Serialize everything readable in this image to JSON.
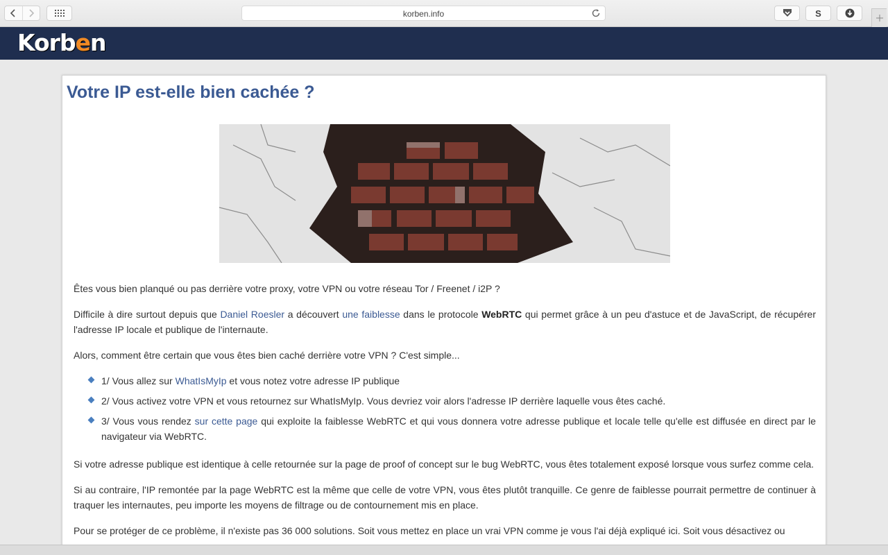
{
  "browser": {
    "url": "korben.info",
    "back_icon": "chevron-left-icon",
    "forward_icon": "chevron-right-icon",
    "grid_icon": "grid-icon",
    "reload_icon": "reload-icon",
    "ext_pocket_icon": "pocket-icon",
    "ext_s_label": "S",
    "ext_download_icon": "download-icon",
    "new_tab_icon": "plus-icon"
  },
  "site": {
    "logo_prefix": "Korb",
    "logo_accent": "e",
    "logo_suffix": "n",
    "header_color": "#1f2e4f",
    "accent_color": "#f08a24"
  },
  "article": {
    "title": "Votre IP est-elle bien cachée ?",
    "image_alt": "brick-wall-image",
    "p1": "Êtes vous bien planqué ou pas derrière votre proxy, votre VPN ou votre réseau Tor / Freenet / i2P ?",
    "p2": {
      "t1": "Difficile à dire surtout depuis que ",
      "link1": "Daniel Roesler",
      "t2": " a découvert ",
      "link2": "une faiblesse",
      "t3": " dans le protocole ",
      "bold": "WebRTC",
      "t4": " qui permet grâce à un peu d'astuce et de JavaScript, de récupérer l'adresse IP locale et publique de l'internaute."
    },
    "p3": "Alors, comment être certain que vous êtes bien caché derrière votre VPN ? C'est simple...",
    "list": {
      "i1_t1": "1/ Vous allez sur ",
      "i1_link": "WhatIsMyIp",
      "i1_t2": " et vous notez votre adresse IP publique",
      "i2": "2/ Vous activez votre VPN et vous retournez sur WhatIsMyIp. Vous devriez voir alors l'adresse IP derrière laquelle vous êtes caché.",
      "i3_t1": "3/ Vous vous rendez ",
      "i3_link": "sur cette page",
      "i3_t2": " qui exploite la faiblesse WebRTC et qui vous donnera votre adresse publique et locale telle qu'elle est diffusée en direct par le navigateur via WebRTC."
    },
    "p4": "Si votre adresse publique est identique à celle retournée sur la page de proof of concept sur le bug WebRTC, vous êtes totalement exposé lorsque vous surfez comme cela.",
    "p5": "Si au contraire, l'IP remontée par la page WebRTC est la même que celle de votre VPN, vous êtes plutôt tranquille. Ce genre de faiblesse pourrait permettre de continuer à traquer les internautes, peu importe les moyens de filtrage ou de contournement mis en place.",
    "p6": "Pour se protéger de ce problème, il n'existe pas 36 000 solutions. Soit vous mettez en place un vrai VPN comme je vous l'ai déjà expliqué ici. Soit vous désactivez ou"
  }
}
